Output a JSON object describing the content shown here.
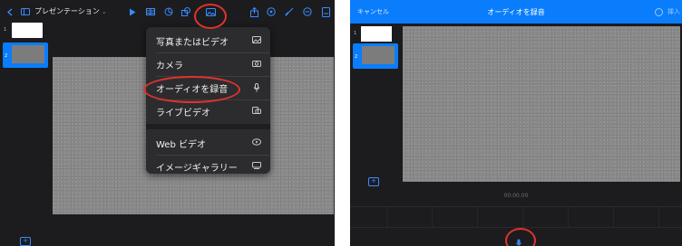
{
  "left": {
    "app_title": "プレゼンテーション",
    "title_chevron": "⌄",
    "slide_numbers": [
      "1",
      "2"
    ],
    "add_label": "+",
    "toolbar_icons": [
      "back-chevron-icon",
      "sidebar-icon",
      "play-icon",
      "table-icon",
      "chart-icon",
      "shape-icon",
      "media-icon",
      "share-icon",
      "comment-icon",
      "brush-icon",
      "more-icon",
      "document-icon"
    ],
    "menu": {
      "items": [
        {
          "label": "写真またはビデオ",
          "icon": "photo-icon"
        },
        {
          "label": "カメラ",
          "icon": "camera-icon"
        },
        {
          "label": "オーディオを録音",
          "icon": "microphone-icon"
        },
        {
          "label": "ライブビデオ",
          "icon": "live-video-icon"
        },
        {
          "label": "Web ビデオ",
          "icon": "web-video-icon"
        },
        {
          "label": "イメージギャラリー",
          "icon": "gallery-icon"
        }
      ]
    }
  },
  "right": {
    "cancel_label": "キャンセル",
    "title": "オーディオを録音",
    "insert_label": "挿入",
    "timecode": "00:00.00",
    "slide_numbers": [
      "1",
      "2"
    ],
    "add_label": "+"
  },
  "colors": {
    "accent": "#0a7dfc",
    "annotation": "#e0332c",
    "background": "#1c1c1e",
    "menu": "#2c2c2e"
  }
}
